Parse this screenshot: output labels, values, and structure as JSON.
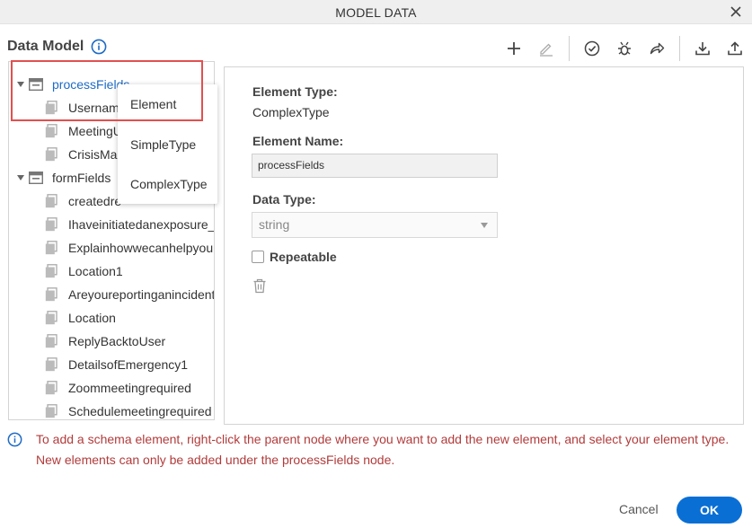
{
  "window": {
    "title": "MODEL DATA"
  },
  "header": {
    "label": "Data Model"
  },
  "tree": {
    "nodes": [
      {
        "label": "processFields",
        "type": "parent",
        "selected": true
      },
      {
        "label": "Usernam",
        "type": "leaf"
      },
      {
        "label": "MeetingU",
        "type": "leaf"
      },
      {
        "label": "CrisisMar",
        "type": "leaf"
      },
      {
        "label": "formFields",
        "type": "parent"
      },
      {
        "label": "createdre",
        "type": "leaf"
      },
      {
        "label": "Ihaveinitiatedanexposure_",
        "type": "leaf"
      },
      {
        "label": "Explainhowwecanhelpyou",
        "type": "leaf"
      },
      {
        "label": "Location1",
        "type": "leaf"
      },
      {
        "label": "Areyoureportinganincident",
        "type": "leaf"
      },
      {
        "label": "Location",
        "type": "leaf"
      },
      {
        "label": "ReplyBacktoUser",
        "type": "leaf"
      },
      {
        "label": "DetailsofEmergency1",
        "type": "leaf"
      },
      {
        "label": "Zoommeetingrequired",
        "type": "leaf"
      },
      {
        "label": "Schedulemeetingrequired",
        "type": "leaf"
      }
    ]
  },
  "context_menu": {
    "items": [
      "Element",
      "SimpleType",
      "ComplexType"
    ]
  },
  "details": {
    "element_type_label": "Element Type:",
    "element_type_value": "ComplexType",
    "element_name_label": "Element Name:",
    "element_name_value": "processFields",
    "data_type_label": "Data Type:",
    "data_type_value": "string",
    "repeatable_label": "Repeatable",
    "repeatable_checked": false
  },
  "info": {
    "line1": "To add a schema element, right-click the parent node where you want to add the new element, and select your element type.",
    "line2": "New elements can only be added under the processFields node."
  },
  "footer": {
    "cancel_label": "Cancel",
    "ok_label": "OK"
  },
  "colors": {
    "accent": "#0a6fd4",
    "warning_text": "#b23b3b",
    "highlight": "#e25050",
    "selected_text": "#1e6bc6"
  }
}
